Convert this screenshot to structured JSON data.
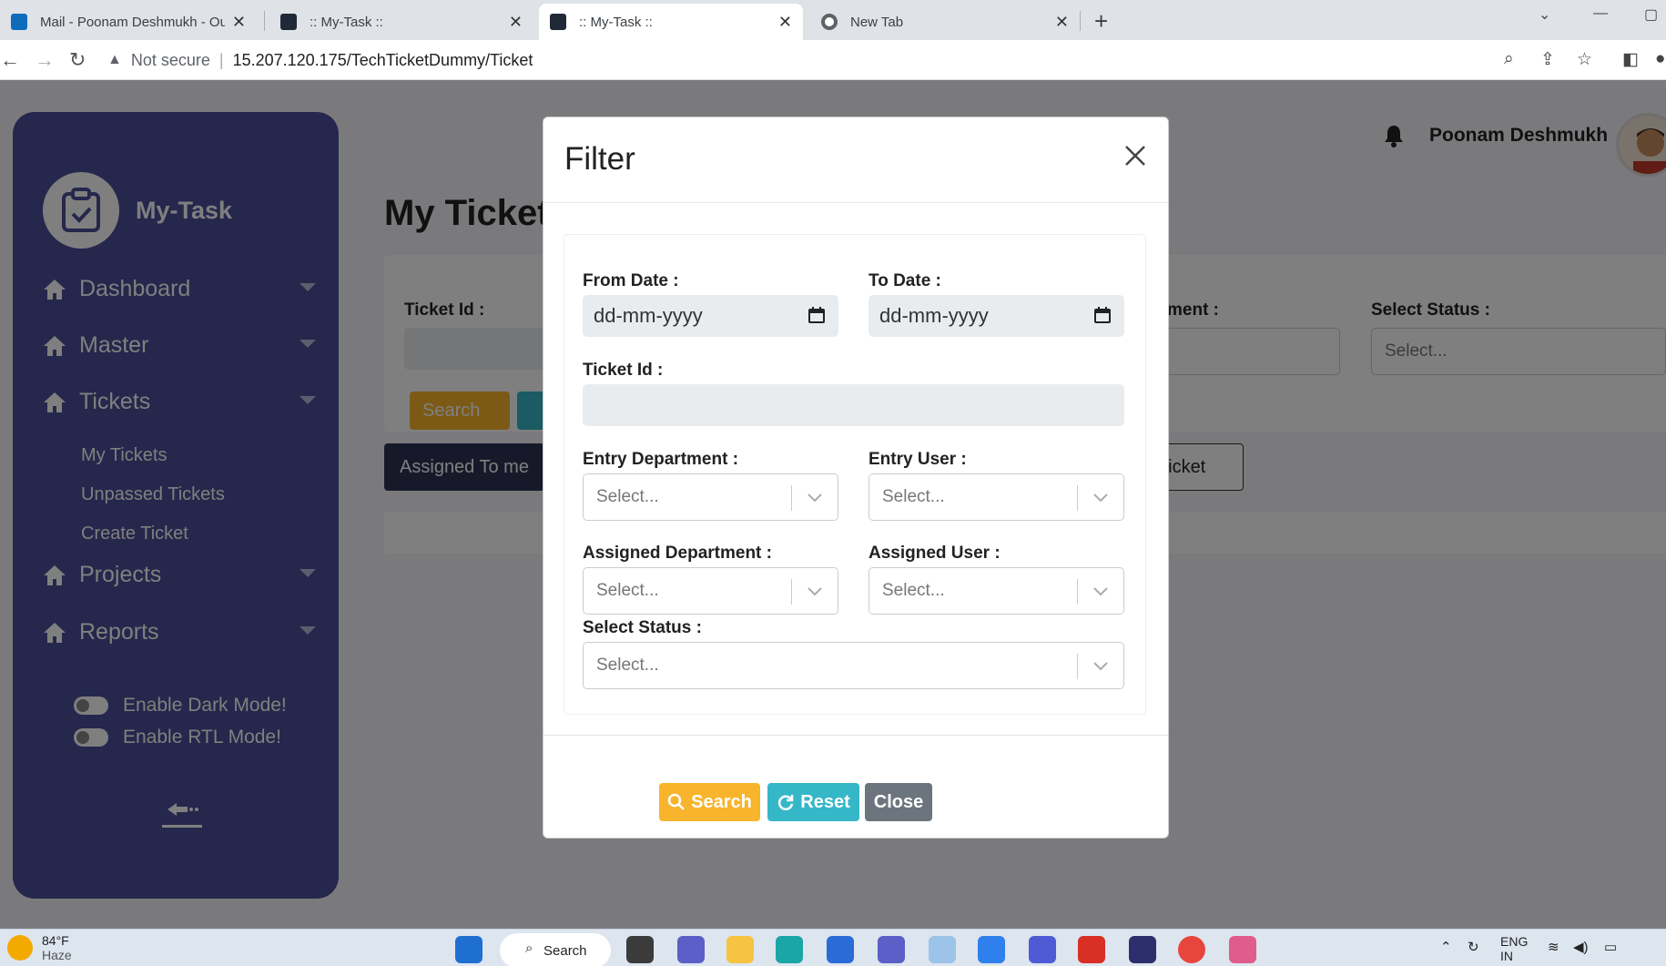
{
  "browser": {
    "tabs": [
      {
        "title": "Mail - Poonam Deshmukh - Outlo",
        "favicon": "outlook-icon",
        "active": false
      },
      {
        "title": ":: My-Task ::",
        "favicon": "react-icon",
        "active": false
      },
      {
        "title": ":: My-Task ::",
        "favicon": "react-icon",
        "active": true
      },
      {
        "title": "New Tab",
        "favicon": "chrome-icon",
        "active": false
      }
    ],
    "security_label": "Not secure",
    "url": "15.207.120.175/TechTicketDummy/Ticket"
  },
  "sidebar": {
    "brand": "My-Task",
    "nav": [
      {
        "label": "Dashboard"
      },
      {
        "label": "Master"
      },
      {
        "label": "Tickets"
      },
      {
        "label": "Projects"
      },
      {
        "label": "Reports"
      }
    ],
    "ticket_subitems": [
      "My Tickets",
      "Unpassed Tickets",
      "Create Ticket"
    ],
    "dark_mode_label": "Enable Dark Mode!",
    "rtl_mode_label": "Enable RTL Mode!"
  },
  "header": {
    "user_name": "Poonam Deshmukh"
  },
  "page": {
    "title": "My Ticket",
    "ticket_id_label": "Ticket Id :",
    "department_label_partial": "ment :",
    "select_status_label": "Select Status :",
    "select_placeholder": "Select...",
    "search_label": "Search",
    "tab_assigned": "Assigned To me",
    "tab_ticket_partial": "Ticket"
  },
  "modal": {
    "title": "Filter",
    "from_date_label": "From Date :",
    "to_date_label": "To Date :",
    "date_placeholder": "dd-mm-yyyy",
    "ticket_id_label": "Ticket Id :",
    "entry_department_label": "Entry Department :",
    "entry_user_label": "Entry User :",
    "assigned_department_label": "Assigned Department :",
    "assigned_user_label": "Assigned User :",
    "select_status_label": "Select Status :",
    "select_placeholder": "Select...",
    "search_button": "Search",
    "reset_button": "Reset",
    "close_button": "Close"
  },
  "taskbar": {
    "temperature": "84°F",
    "weather": "Haze",
    "search": "Search",
    "lang": "ENG",
    "region": "IN"
  },
  "colors": {
    "sidebar": "#4b4f98",
    "search_btn": "#f8b42c",
    "reset_btn": "#35b7c8",
    "close_btn": "#6c757d",
    "tab_dark": "#2e3257"
  }
}
